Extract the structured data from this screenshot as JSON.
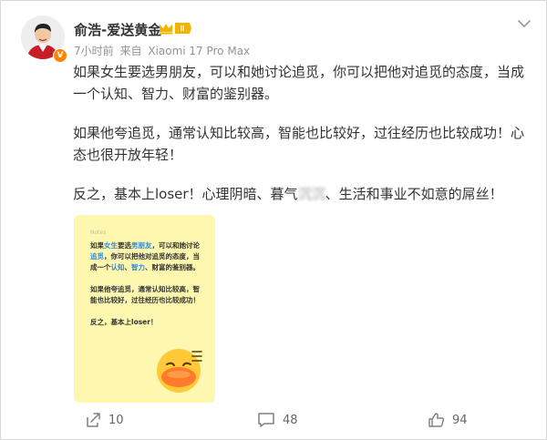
{
  "user": {
    "name": "俞浩-爱送黄金",
    "verified_badge": "V",
    "member_badge": "II",
    "time": "7小时前",
    "source_prefix": "来自",
    "device": "Xiaomi 17 Pro Max",
    "avatar_icon": "avatar-portrait",
    "colors": {
      "verified": "#ff8200",
      "member": "#f3b400",
      "link_blue": "#2f8ad8"
    }
  },
  "post": {
    "paragraphs": [
      "如果女生要选男朋友，可以和她讨论追觅，你可以把他对追觅的态度，当成一个认知、智力、财富的鉴别器。",
      "如果他夸追觅，通常认知比较高，智能也比较好，过往经历也比较成功！心态也很开放年轻！"
    ],
    "p3_before": "反之，基本上loser！心理阴暗、暮气",
    "p3_blurred": "沉沉",
    "p3_after": "、生活和事业不如意的屌丝！"
  },
  "card": {
    "app_label": "Notes",
    "background": "#fdf7b0",
    "p1": [
      {
        "t": "如果"
      },
      {
        "t": "女生",
        "hl": true
      },
      {
        "t": "要选"
      },
      {
        "t": "男朋友",
        "hl": true
      },
      {
        "t": "，可以和她讨论"
      },
      {
        "t": "追觅",
        "hl": true
      },
      {
        "t": "，你可以把他对追觅的态度，当成一个"
      },
      {
        "t": "认知",
        "hl": true
      },
      {
        "t": "、"
      },
      {
        "t": "智力",
        "hl": true
      },
      {
        "t": "、财富的鉴别器。"
      }
    ],
    "p2": "如果他夸追觅，通常认知比较高，智能也比较好，过往经历也比较成功！",
    "p3": "反之，基本上loser！",
    "emoji_icon": "duck-face-emoji"
  },
  "actions": [
    {
      "icon": "share-icon",
      "count": "10"
    },
    {
      "icon": "comment-icon",
      "count": "48"
    },
    {
      "icon": "like-icon",
      "count": "94"
    }
  ],
  "menu_icon": "chevron-down-icon"
}
